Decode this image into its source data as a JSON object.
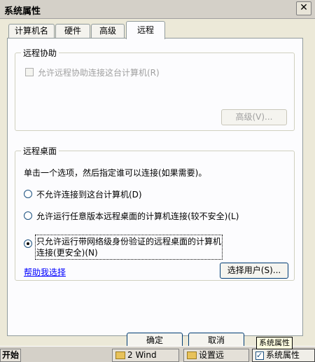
{
  "window": {
    "title": "系统属性",
    "close_glyph": "✕"
  },
  "tabs": [
    {
      "label": "计算机名",
      "active": false
    },
    {
      "label": "硬件",
      "active": false
    },
    {
      "label": "高级",
      "active": false
    },
    {
      "label": "远程",
      "active": true
    }
  ],
  "remote_assistance": {
    "title": "远程协助",
    "checkbox_label": "允许远程协助连接这台计算机(R)",
    "checked": false,
    "advanced_button": "高级(V)..."
  },
  "remote_desktop": {
    "title": "远程桌面",
    "instruction": "单击一个选项，然后指定谁可以连接(如果需要)。",
    "options": [
      {
        "label": "不允许连接到这台计算机(D)",
        "checked": false
      },
      {
        "label": "允许运行任意版本远程桌面的计算机连接(较不安全)(L)",
        "checked": false
      },
      {
        "label_line1": "只允许运行带网络级身份验证的远程桌面的计算机",
        "label_line2": "连接(更安全)(N)",
        "checked": true
      }
    ],
    "help_link": "帮助我选择",
    "select_users_button": "选择用户(S)..."
  },
  "dialog_buttons": {
    "ok": "确定",
    "cancel": "取消"
  },
  "taskbar": {
    "start": "开始",
    "items": [
      {
        "label": "2 Wind",
        "icon": "folder-icon"
      },
      {
        "label": "设置远",
        "icon": "folder-icon"
      },
      {
        "label": "系统属性",
        "icon": "checkbox-icon",
        "active": true
      }
    ],
    "tooltip": "系统属性"
  }
}
